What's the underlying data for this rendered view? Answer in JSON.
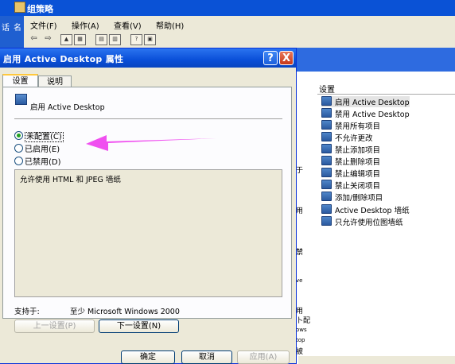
{
  "background_window": {
    "title": "组策略",
    "left_fragments": [
      "话",
      "名"
    ],
    "menu": [
      "文件(F)",
      "操作(A)",
      "查看(V)",
      "帮助(H)"
    ],
    "toolbar_icons": [
      "back-arrow-icon",
      "forward-arrow-icon",
      "up-folder-icon",
      "show-tree-icon",
      "properties-icon",
      "export-icon",
      "help-icon",
      "console-icon"
    ],
    "right_pane": {
      "header": "设置",
      "items": [
        "启用 Active Desktop",
        "禁用 Active Desktop",
        "禁用所有项目",
        "不允许更改",
        "禁止添加项目",
        "禁止删除项目",
        "禁止编辑项目",
        "禁止关闭项目",
        "添加/删除项目",
        "Active Desktop 墙纸",
        "只允许使用位图墙纸"
      ]
    },
    "clipped_fragments": [
      "于",
      "用",
      "禁",
      "ve",
      "用",
      "卜配",
      "ows",
      "top",
      "被"
    ]
  },
  "dialog": {
    "title": "启用 Active Desktop 属性",
    "help_label": "?",
    "close_label": "X",
    "tabs": [
      "设置",
      "说明"
    ],
    "policy_name": "启用 Active Desktop",
    "options": [
      "未配置(C)",
      "已启用(E)",
      "已禁用(D)"
    ],
    "selected_option": "未配置(C)",
    "description": "允许使用 HTML 和 JPEG 墙纸",
    "supported_label": "支持于:",
    "supported_value": "至少 Microsoft Windows 2000",
    "prev_label": "上一设置(P)",
    "next_label": "下一设置(N)",
    "ok_label": "确定",
    "cancel_label": "取消",
    "apply_label": "应用(A)"
  },
  "annotation": {
    "arrow_color": "#f050f0"
  }
}
